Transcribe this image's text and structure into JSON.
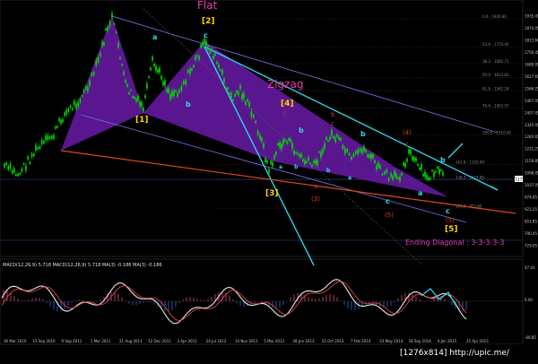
{
  "chart_data": {
    "type": "candlestick",
    "title": "",
    "y_ticks": [
      "1935.45",
      "1874.05",
      "1813.60",
      "1750.45",
      "1689.05",
      "1627.65",
      "1566.25",
      "1467.05",
      "1407.45",
      "1345.05",
      "1283.65",
      "1221.25",
      "1159.85",
      "1098.45",
      "1037.05",
      "974.65",
      "923.25",
      "851.85",
      "790.45",
      "729.05"
    ],
    "x_ticks": [
      "30 Mar 2010",
      "15 Sep 2010",
      "9 Sep 2011",
      "1 Mar 2011",
      "21 Aug 2011",
      "12 Dec 2011",
      "3 Apr 2012",
      "24 Jul 2012",
      "14 Nov 2012",
      "5 Mar 2013",
      "28 Jun 2013",
      "15 Oct 2013",
      "7 Feb 2014",
      "23 May 2014",
      "18 Sep 2014",
      "4 Jan 2015",
      "25 Apr 2015"
    ],
    "price_box": "1177.95",
    "fib_levels": [
      {
        "label": "0.0 - 1920.80",
        "value": 1920.8
      },
      {
        "label": "23.6 - 1774.45",
        "value": 1774.45
      },
      {
        "label": "38.2 - 1685.71",
        "value": 1685.71
      },
      {
        "label": "50.0 - 1613.83",
        "value": 1613.83
      },
      {
        "label": "61.8 - 1542.18",
        "value": 1542.18
      },
      {
        "label": "76.4 - 1453.57",
        "value": 1453.57
      },
      {
        "label": "100.0 - 1310.50",
        "value": 1310.5
      },
      {
        "label": "161.8 - 1155.90",
        "value": 1155.9
      },
      {
        "label": "138.2 - 1074.60",
        "value": 1074.6
      },
      {
        "label": "161.8 - 923.60",
        "value": 923.6
      }
    ],
    "wave_labels": {
      "flat": "Flat",
      "zigzag": "Zigzag",
      "ending_diagonal": "Ending Diagonal : 3-3-3-3-3",
      "w1": "[1]",
      "w2": "[2]",
      "w3": "[3]",
      "w4": "[4]",
      "w5": "[5]",
      "a1": "a",
      "b1": "b",
      "c1": "c",
      "r_a": "a",
      "r_b": "b",
      "r_c": "c",
      "r3": "(3)",
      "r4": "(4)",
      "r5": "(5)"
    },
    "macd_label": "MACD(12,26,9) 5.718  MACD(12,26,9) 5.718  MA(3) -0.186  MA(3) -0.186",
    "macd_ticks": [
      "47.43",
      "0.00",
      "-69.85"
    ]
  },
  "credit": "[1276x814] http://upic.me/",
  "colors": {
    "background": "#000000",
    "candle": "#00e000",
    "triangle": "#7a1fb0",
    "channel": "#6a6ad8",
    "cyan_line": "#2ed3e6",
    "orange_line": "#e0481c"
  }
}
